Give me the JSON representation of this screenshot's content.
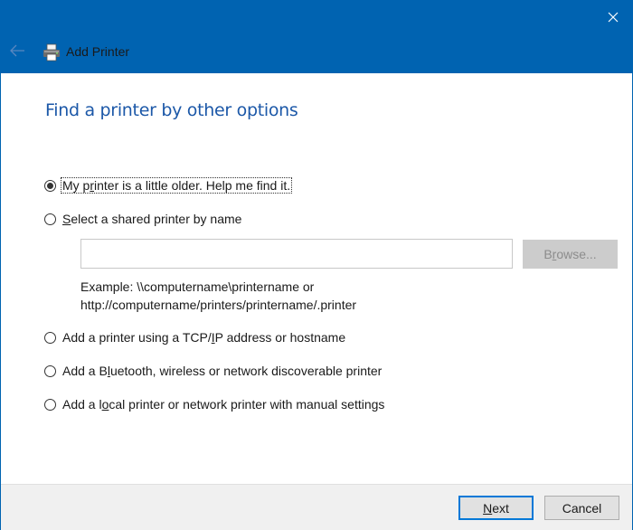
{
  "window": {
    "title": "Add Printer",
    "accent_color": "#0063b1",
    "icons": {
      "back": "back-arrow-icon",
      "app": "printer-icon",
      "close": "close-icon"
    }
  },
  "page": {
    "heading": "Find a printer by other options",
    "options": [
      {
        "id": "older",
        "pre": "My p",
        "mnemonic": "r",
        "post": "inter is a little older. Help me find it.",
        "checked": true
      },
      {
        "id": "shared",
        "pre": "",
        "mnemonic": "S",
        "post": "elect a shared printer by name",
        "checked": false
      },
      {
        "id": "tcpip",
        "pre": "Add a printer using a TCP/",
        "mnemonic": "I",
        "post": "P address or hostname",
        "checked": false
      },
      {
        "id": "bluetooth",
        "pre": "Add a B",
        "mnemonic": "l",
        "post": "uetooth, wireless or network discoverable printer",
        "checked": false
      },
      {
        "id": "local",
        "pre": "Add a l",
        "mnemonic": "o",
        "post": "cal printer or network printer with manual settings",
        "checked": false
      }
    ],
    "shared_input": {
      "value": "",
      "placeholder": ""
    },
    "browse_button": {
      "pre": "B",
      "mnemonic": "r",
      "post": "owse...",
      "enabled": false
    },
    "example_line1": "Example: \\\\computername\\printername or",
    "example_line2": "http://computername/printers/printername/.printer"
  },
  "footer": {
    "next": {
      "mnemonic": "N",
      "post": "ext"
    },
    "cancel": "Cancel"
  }
}
